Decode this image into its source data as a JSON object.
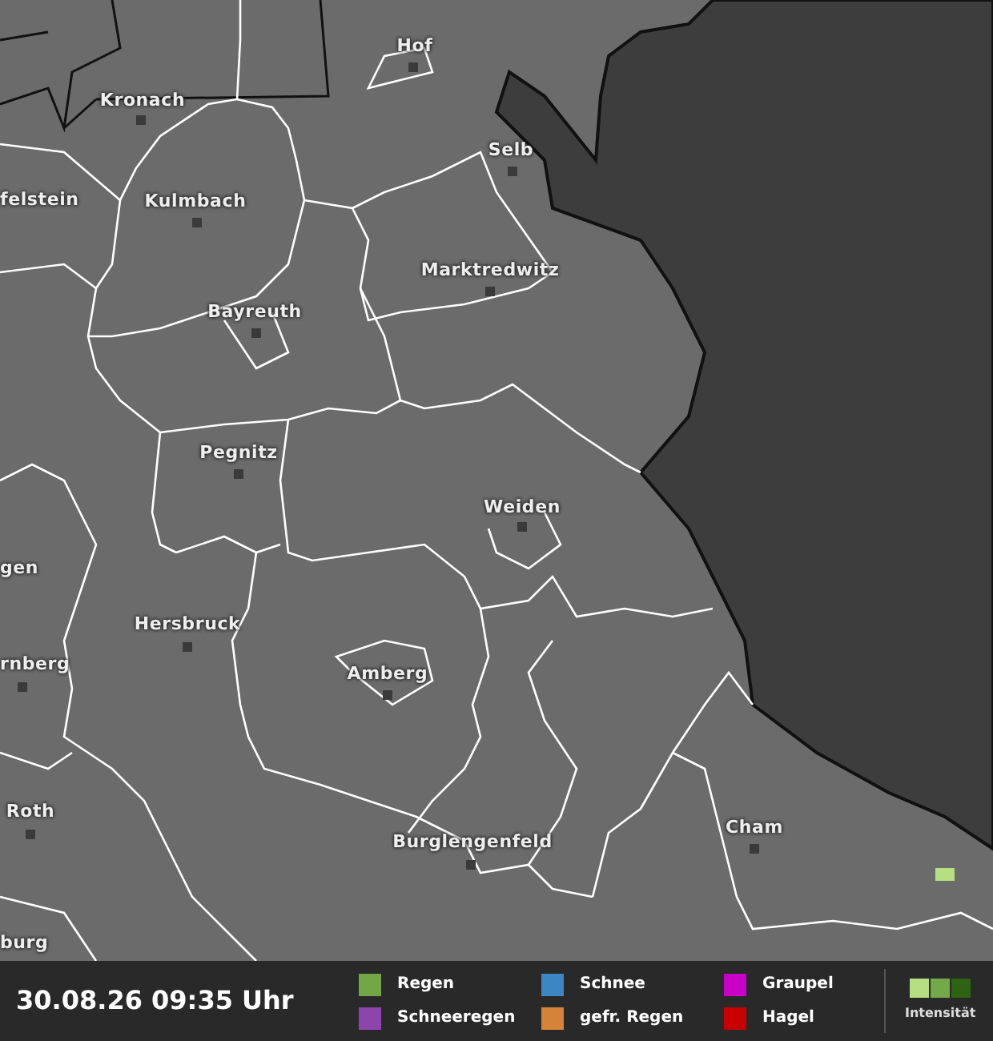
{
  "map": {
    "places": [
      {
        "name": "Hof"
      },
      {
        "name": "Kronach"
      },
      {
        "name": "Selb"
      },
      {
        "name": "felstein"
      },
      {
        "name": "Kulmbach"
      },
      {
        "name": "Marktredwitz"
      },
      {
        "name": "Bayreuth"
      },
      {
        "name": "Pegnitz"
      },
      {
        "name": "Weiden"
      },
      {
        "name": "gen"
      },
      {
        "name": "Hersbruck"
      },
      {
        "name": "rnberg"
      },
      {
        "name": "Amberg"
      },
      {
        "name": "Roth"
      },
      {
        "name": "Cham"
      },
      {
        "name": "Burglengenfeld"
      },
      {
        "name": "burg"
      }
    ]
  },
  "legend": {
    "timestamp": "30.08.26 09:35 Uhr",
    "types": [
      {
        "label": "Regen",
        "color": "#72a646"
      },
      {
        "label": "Schneeregen",
        "color": "#8e44ad"
      },
      {
        "label": "Schnee",
        "color": "#3d86c4"
      },
      {
        "label": "gefr. Regen",
        "color": "#d6833a"
      },
      {
        "label": "Graupel",
        "color": "#c800c8"
      },
      {
        "label": "Hagel",
        "color": "#c80000"
      }
    ],
    "intensity": {
      "label": "Intensität",
      "levels": [
        {
          "color": "#b5df80"
        },
        {
          "color": "#74a94a"
        },
        {
          "color": "#2e6312"
        }
      ]
    }
  }
}
